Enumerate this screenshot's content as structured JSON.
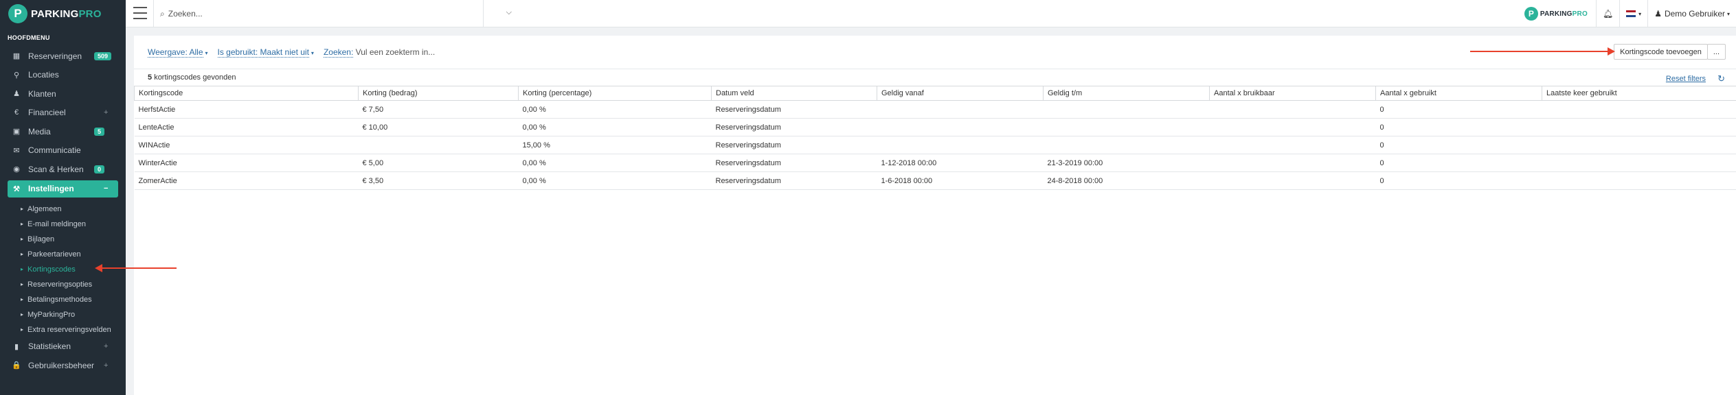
{
  "brand": {
    "name_main": "PARKING",
    "name_accent": "PRO",
    "mark": "P"
  },
  "sidebar": {
    "heading": "HOOFDMENU",
    "items": [
      {
        "label": "Reserveringen",
        "icon": "calendar-icon",
        "glyph": "▦",
        "badge": "509"
      },
      {
        "label": "Locaties",
        "icon": "map-pin-icon",
        "glyph": "⚲"
      },
      {
        "label": "Klanten",
        "icon": "user-icon",
        "glyph": "♟"
      },
      {
        "label": "Financieel",
        "icon": "euro-icon",
        "glyph": "€",
        "plus": "+"
      },
      {
        "label": "Media",
        "icon": "image-icon",
        "glyph": "▣",
        "badge": "5"
      },
      {
        "label": "Communicatie",
        "icon": "envelope-icon",
        "glyph": "✉"
      },
      {
        "label": "Scan & Herken",
        "icon": "camera-icon",
        "glyph": "◉",
        "badge": "0"
      },
      {
        "label": "Instellingen",
        "icon": "wrench-icon",
        "glyph": "⚒",
        "plus": "−"
      }
    ],
    "sub_items": [
      "Algemeen",
      "E-mail meldingen",
      "Bijlagen",
      "Parkeertarieven",
      "Kortingscodes",
      "Reserveringsopties",
      "Betalingsmethodes",
      "MyParkingPro",
      "Extra reserveringsvelden"
    ],
    "bottom_items": [
      {
        "label": "Statistieken",
        "icon": "bar-chart-icon",
        "glyph": "▮",
        "plus": "+"
      },
      {
        "label": "Gebruikersbeheer",
        "icon": "lock-icon",
        "glyph": "🔒",
        "plus": "+"
      }
    ]
  },
  "topbar": {
    "search_placeholder": "Zoeken...",
    "user_label": "Demo Gebruiker"
  },
  "filters": [
    {
      "label": "Weergave: Alle",
      "value": ""
    },
    {
      "label": "Is gebruikt: Maakt niet uit",
      "value": ""
    },
    {
      "label": "Zoeken:",
      "value": "Vul een zoekterm in..."
    }
  ],
  "actions": {
    "add_label": "Kortingscode toevoegen",
    "more_label": "..."
  },
  "results": {
    "count": "5",
    "text": "kortingscodes gevonden",
    "reset_label": "Reset filters"
  },
  "table": {
    "headers": [
      "Kortingscode",
      "Korting (bedrag)",
      "Korting (percentage)",
      "Datum veld",
      "Geldig vanaf",
      "Geldig t/m",
      "Aantal x bruikbaar",
      "Aantal x gebruikt",
      "Laatste keer gebruikt"
    ],
    "rows": [
      [
        "HerfstActie",
        "€ 7,50",
        "0,00 %",
        "Reserveringsdatum",
        "",
        "",
        "",
        "0",
        ""
      ],
      [
        "LenteActie",
        "€ 10,00",
        "0,00 %",
        "Reserveringsdatum",
        "",
        "",
        "",
        "0",
        ""
      ],
      [
        "WINActie",
        "",
        "15,00 %",
        "Reserveringsdatum",
        "",
        "",
        "",
        "0",
        ""
      ],
      [
        "WinterActie",
        "€ 5,00",
        "0,00 %",
        "Reserveringsdatum",
        "1-12-2018 00:00",
        "21-3-2019 00:00",
        "",
        "0",
        ""
      ],
      [
        "ZomerActie",
        "€ 3,50",
        "0,00 %",
        "Reserveringsdatum",
        "1-6-2018 00:00",
        "24-8-2018 00:00",
        "",
        "0",
        ""
      ]
    ]
  },
  "colors": {
    "accent": "#2bb39a",
    "sidebar_bg": "#232d36",
    "link": "#2e6da4",
    "annotation_arrow": "#e8412c"
  }
}
